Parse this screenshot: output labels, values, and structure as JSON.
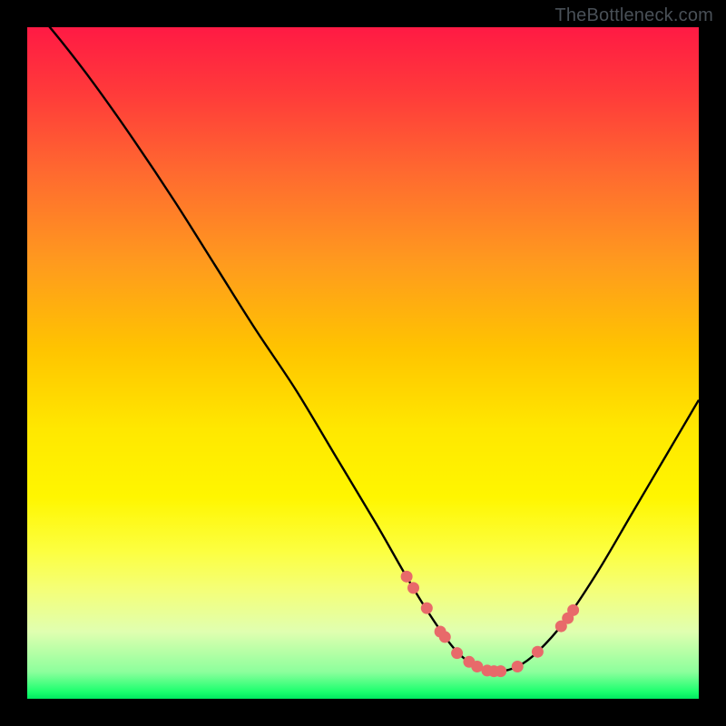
{
  "watermark": "TheBottleneck.com",
  "chart_data": {
    "type": "line",
    "title": "",
    "xlabel": "",
    "ylabel": "",
    "xlim": [
      0,
      100
    ],
    "ylim": [
      0,
      100
    ],
    "grid": false,
    "legend": "none",
    "series": [
      {
        "name": "bottleneck-curve",
        "x": [
          0,
          5,
          10,
          16,
          22,
          28,
          34,
          40,
          46,
          52,
          56,
          59,
          62,
          64,
          66,
          68,
          70,
          73,
          76,
          80,
          85,
          90,
          95,
          100
        ],
        "y": [
          104,
          98,
          91.5,
          83,
          74,
          64.5,
          55,
          46,
          36,
          26,
          19,
          14,
          9.5,
          7,
          5.3,
          4.3,
          4,
          4.8,
          7,
          11.5,
          19,
          27.5,
          36,
          44.5
        ]
      }
    ],
    "markers": [
      {
        "name": "highlight-points",
        "color": "#e86a6a",
        "x": [
          56.5,
          57.5,
          59.5,
          61.5,
          62.2,
          64,
          65.8,
          67,
          68.5,
          69.5,
          70.5,
          73,
          76,
          79.5,
          80.5,
          81.3
        ],
        "y": [
          18.2,
          16.5,
          13.5,
          10,
          9.2,
          6.8,
          5.5,
          4.8,
          4.2,
          4.1,
          4.1,
          4.8,
          7,
          10.8,
          12,
          13.2
        ]
      }
    ]
  }
}
